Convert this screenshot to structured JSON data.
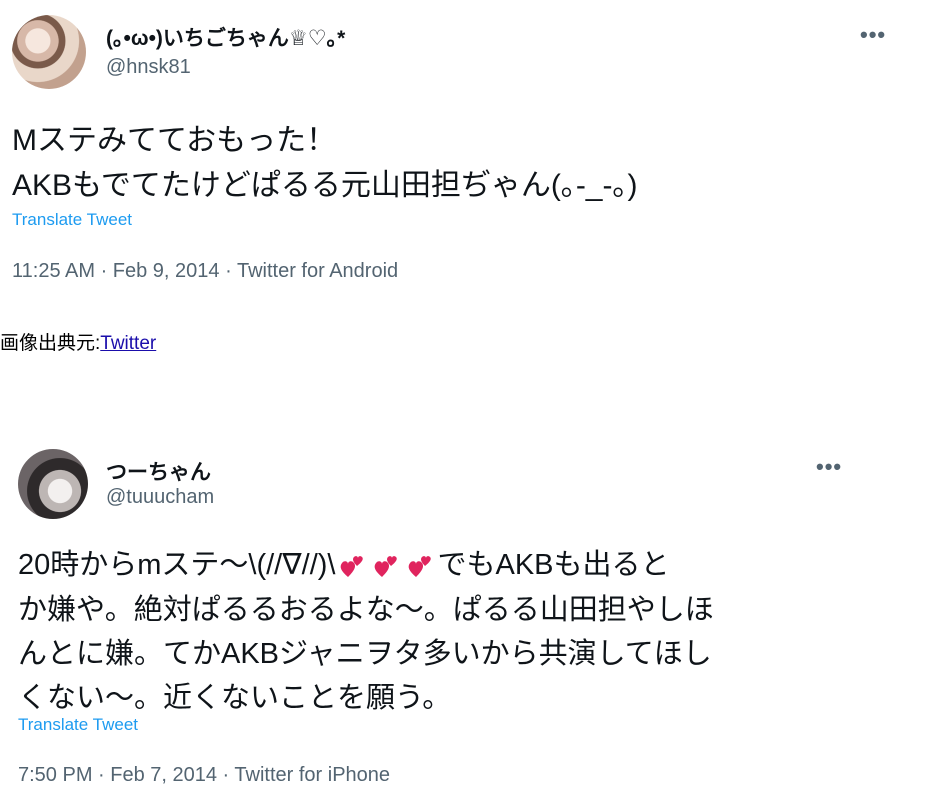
{
  "tweets": [
    {
      "display_name": "(｡•ω•)いちごちゃん♕♡｡*",
      "handle": "@hnsk81",
      "text_lines": [
        "Mステみてておもった！",
        "AKBもでてたけどぱるる元山田担ぢゃん(｡-_-｡)"
      ],
      "translate_label": "Translate Tweet",
      "meta": "11:25 AM · Feb 9, 2014 · Twitter for Android",
      "more_icon": "ellipsis-icon"
    },
    {
      "display_name": "つーちゃん",
      "handle": "@tuuucham",
      "text_part1": "20時からmステ〜\\(//∇//)\\",
      "text_part2": "でもAKBも出ると",
      "text_lines_rest": [
        "か嫌や。絶対ぱるるおるよな〜。ぱるる山田担やしほ",
        "んとに嫌。てかAKBジャニヲタ多いから共演してほし",
        "くない〜。近くないことを願う。"
      ],
      "emoji": "two-hearts-icon",
      "emoji_count": 3,
      "translate_label": "Translate Tweet",
      "meta": "7:50 PM · Feb 7, 2014 · Twitter for iPhone",
      "more_icon": "ellipsis-icon"
    }
  ],
  "credit": {
    "prefix": "画像出典元:",
    "link_text": "Twitter"
  },
  "colors": {
    "link": "#1d9bf0",
    "secondary_text": "#536471",
    "heart": "#e0245e"
  }
}
